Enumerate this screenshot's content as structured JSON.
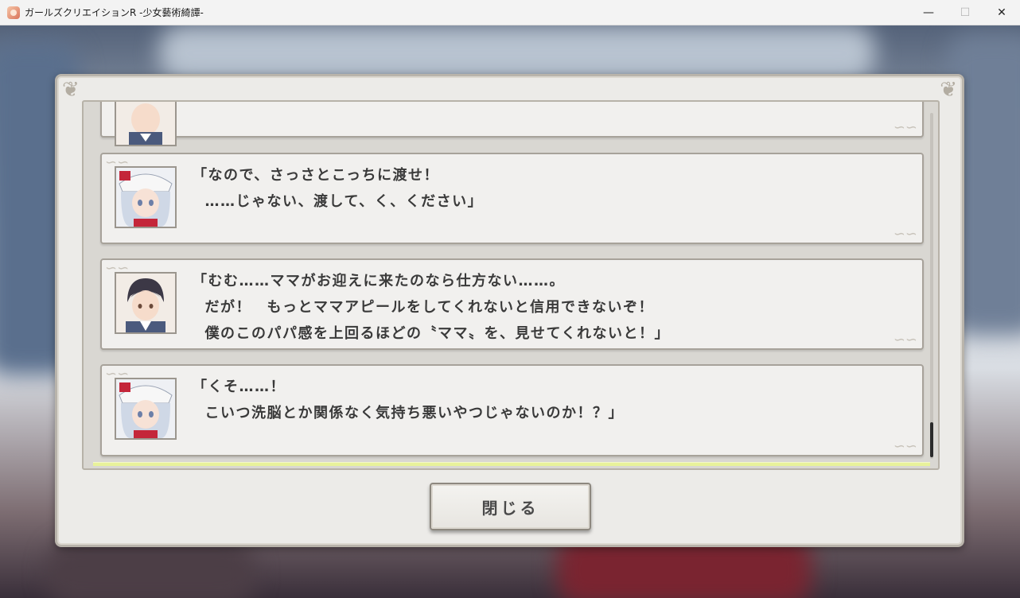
{
  "window": {
    "title": "ガールズクリエイションR -少女藝術綺譚-",
    "controls": {
      "minimize": "—",
      "maximize": "☐",
      "close": "✕"
    }
  },
  "log": {
    "entries": [
      {
        "speaker_icon": "boy-portrait-icon",
        "lines": []
      },
      {
        "speaker_icon": "girl-portrait-icon",
        "lines": [
          "「なので、さっさとこっちに渡せ！",
          "  ……じゃない、渡して、く、ください」"
        ]
      },
      {
        "speaker_icon": "boy-portrait-icon",
        "lines": [
          "「むむ……ママがお迎えに来たのなら仕方ない……。",
          "  だが！　もっとママアピールをしてくれないと信用できないぞ！",
          "  僕のこのパパ感を上回るほどの〝ママ〟を、見せてくれないと！」"
        ]
      },
      {
        "speaker_icon": "girl-portrait-icon",
        "lines": [
          "「くそ……！",
          "  こいつ洗脳とか関係なく気持ち悪いやつじゃないのか！？」"
        ]
      }
    ],
    "scroll": {
      "position": 1.0
    }
  },
  "close_button": {
    "label": "閉じる"
  },
  "colors": {
    "panel": "#ecebe8",
    "entry": "#f1f0ee",
    "highlight": "#e8f29a",
    "text": "#3a3a3a"
  }
}
